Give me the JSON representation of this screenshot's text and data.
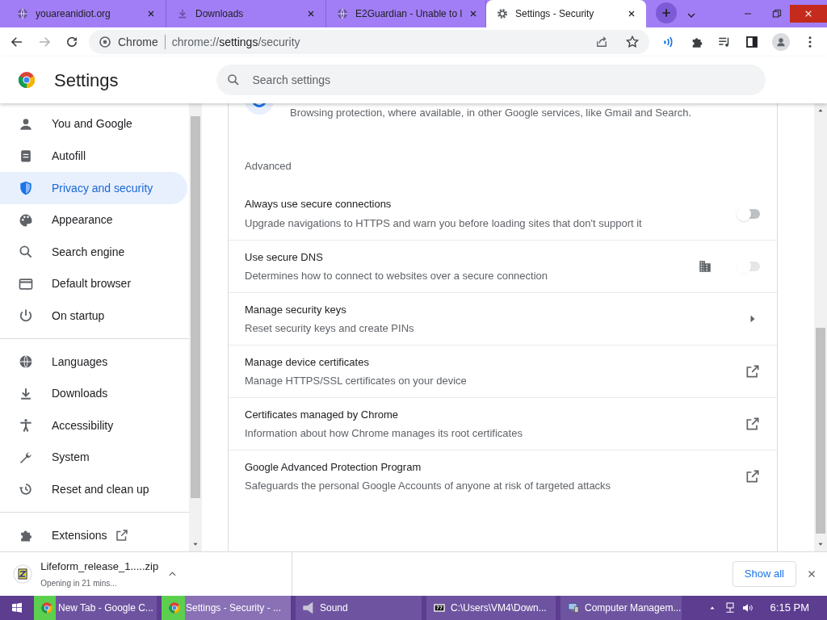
{
  "tabs": [
    {
      "title": "youareanidiot.org",
      "selected": false
    },
    {
      "title": "Downloads",
      "selected": false
    },
    {
      "title": "E2Guardian - Unable to l",
      "selected": false
    },
    {
      "title": "Settings - Security",
      "selected": true
    }
  ],
  "toolbar": {
    "site_label": "Chrome",
    "url_host": "chrome://",
    "url_bold": "settings",
    "url_rest": "/security"
  },
  "header": {
    "title": "Settings",
    "search": {
      "placeholder": "Search settings"
    }
  },
  "sidebar": {
    "groups": [
      {
        "items": [
          {
            "label": "You and Google",
            "kind": "page",
            "selected": false
          },
          {
            "label": "Autofill",
            "kind": "page",
            "selected": false
          },
          {
            "label": "Privacy and security",
            "kind": "page",
            "selected": true
          },
          {
            "label": "Appearance",
            "kind": "page",
            "selected": false
          },
          {
            "label": "Search engine",
            "kind": "page",
            "selected": false
          },
          {
            "label": "Default browser",
            "kind": "page",
            "selected": false
          },
          {
            "label": "On startup",
            "kind": "page",
            "selected": false
          }
        ]
      },
      {
        "items": [
          {
            "label": "Languages",
            "kind": "page",
            "selected": false
          },
          {
            "label": "Downloads",
            "kind": "page",
            "selected": false
          },
          {
            "label": "Accessibility",
            "kind": "page",
            "selected": false
          },
          {
            "label": "System",
            "kind": "page",
            "selected": false
          },
          {
            "label": "Reset and clean up",
            "kind": "page",
            "selected": false
          }
        ]
      },
      {
        "items": [
          {
            "label": "Extensions",
            "kind": "external",
            "selected": false
          }
        ]
      }
    ]
  },
  "content": {
    "partial_text": "Browsing protection, where available, in other Google services, like Gmail and Search.",
    "section_title": "Advanced",
    "rows": [
      {
        "kind": "toggle",
        "title": "Always use secure connections",
        "subtitle": "Upgrade navigations to HTTPS and warn you before loading sites that don't support it",
        "on": false,
        "disabled": false,
        "managed": false
      },
      {
        "kind": "toggle",
        "title": "Use secure DNS",
        "subtitle": "Determines how to connect to websites over a secure connection",
        "on": false,
        "disabled": true,
        "managed": true
      },
      {
        "kind": "arrow",
        "title": "Manage security keys",
        "subtitle": "Reset security keys and create PINs"
      },
      {
        "kind": "external",
        "title": "Manage device certificates",
        "subtitle": "Manage HTTPS/SSL certificates on your device"
      },
      {
        "kind": "external",
        "title": "Certificates managed by Chrome",
        "subtitle": "Information about how Chrome manages its root certificates"
      },
      {
        "kind": "external",
        "title": "Google Advanced Protection Program",
        "subtitle": "Safeguards the personal Google Accounts of anyone at risk of targeted attacks"
      }
    ]
  },
  "download_bar": {
    "file": "Lifeform_release_1.....zip",
    "status": "Opening in 21 mins...",
    "show_all": "Show all"
  },
  "taskbar": {
    "items": [
      {
        "label": "New Tab - Google C...",
        "selected": false,
        "level": 0.18
      },
      {
        "label": "Settings - Security - ...",
        "selected": true,
        "level": 0.18
      },
      {
        "label": "Sound",
        "selected": false
      },
      {
        "label": "C:\\Users\\VM4\\Down...",
        "selected": false
      },
      {
        "label": "Computer Managem...",
        "selected": false
      }
    ],
    "time": "6:15 PM"
  }
}
